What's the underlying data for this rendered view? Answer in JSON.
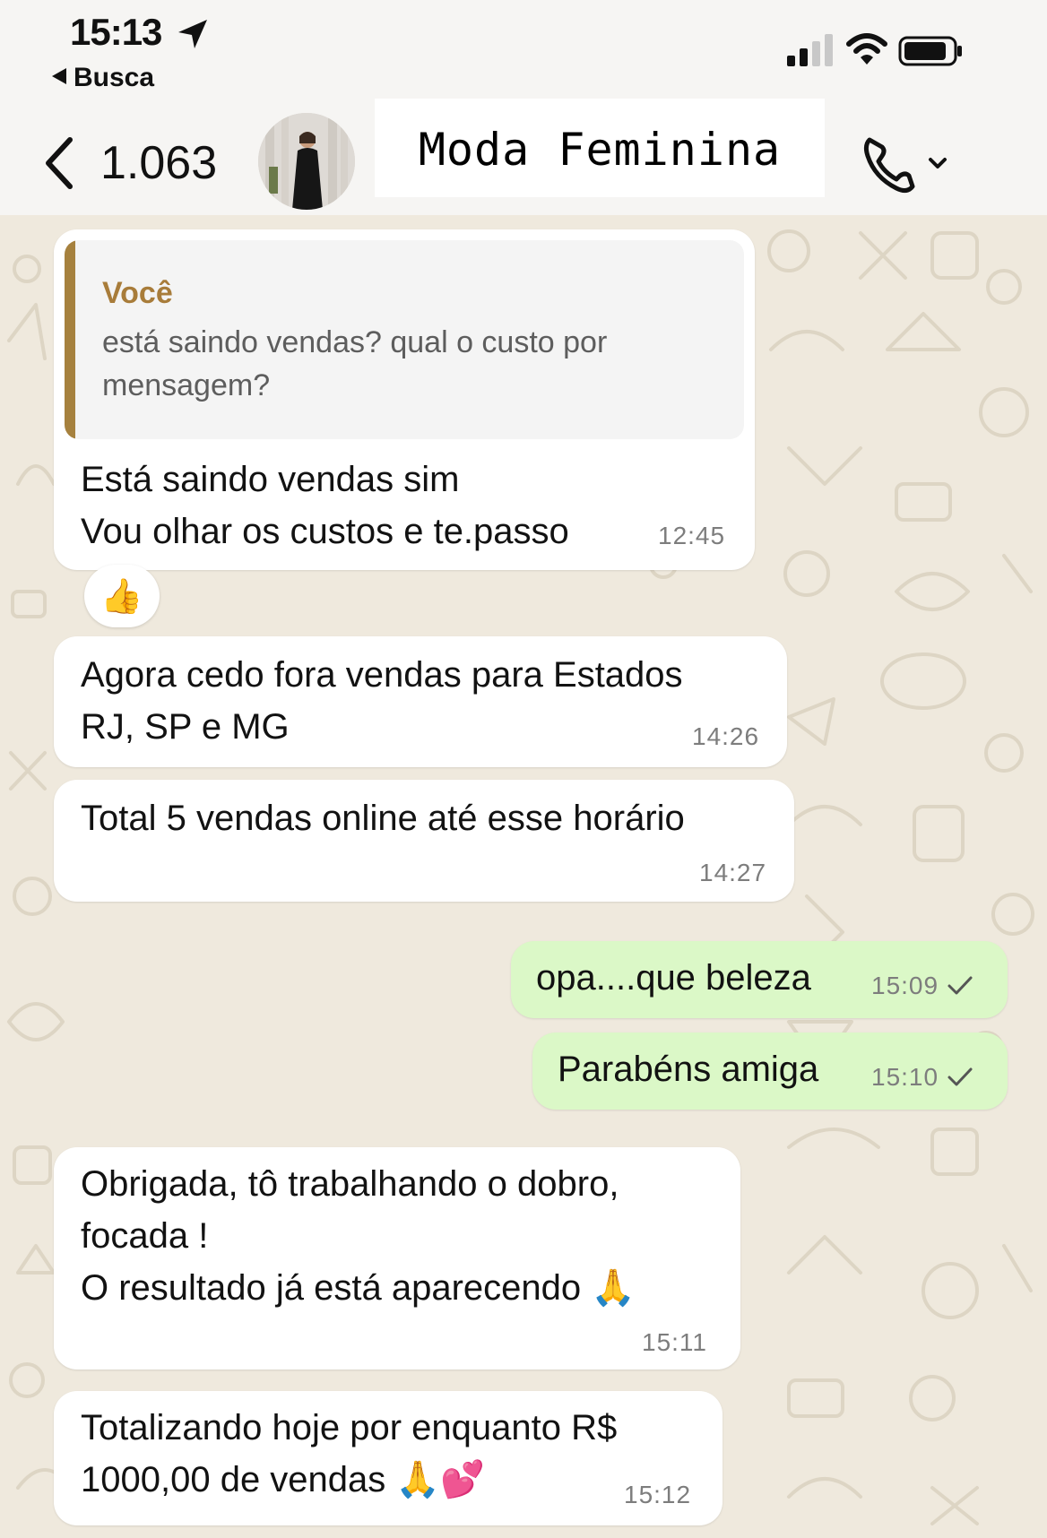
{
  "status_bar": {
    "time": "15:13",
    "back_app": "Busca",
    "icons": [
      "location-arrow-icon",
      "signal-icon",
      "wifi-icon",
      "battery-icon"
    ]
  },
  "header": {
    "unread_count": "1.063",
    "contact_name": "Moda Feminina",
    "icons": [
      "back-chevron-icon",
      "phone-icon",
      "chevron-down-icon"
    ]
  },
  "colors": {
    "chat_background": "#efe9dd",
    "incoming_bubble": "#ffffff",
    "outgoing_bubble": "#dbf8c7",
    "quote_accent": "#a6813e"
  },
  "messages": [
    {
      "direction": "in",
      "quote": {
        "author": "Você",
        "lines": [
          "está saindo vendas? qual o custo por",
          "mensagem?"
        ]
      },
      "lines": [
        "Está saindo vendas sim",
        "Vou olhar os custos e te.passo"
      ],
      "time": "12:45",
      "reaction": "👍"
    },
    {
      "direction": "in",
      "lines": [
        "Agora cedo fora vendas para Estados",
        "RJ, SP e MG"
      ],
      "time": "14:26"
    },
    {
      "direction": "in",
      "lines": [
        "Total 5 vendas online até  esse horário"
      ],
      "time": "14:27"
    },
    {
      "direction": "out",
      "lines": [
        "opa....que beleza"
      ],
      "time": "15:09",
      "status": "check-icon"
    },
    {
      "direction": "out",
      "lines": [
        "Parabéns amiga"
      ],
      "time": "15:10",
      "status": "check-icon"
    },
    {
      "direction": "in",
      "lines": [
        "Obrigada,  tô trabalhando o dobro,",
        "focada !",
        "O resultado já está aparecendo 🙏"
      ],
      "time": "15:11"
    },
    {
      "direction": "in",
      "lines": [
        "Totalizando hoje por enquanto R$",
        "1000,00 de vendas 🙏💕"
      ],
      "time": "15:12"
    }
  ]
}
